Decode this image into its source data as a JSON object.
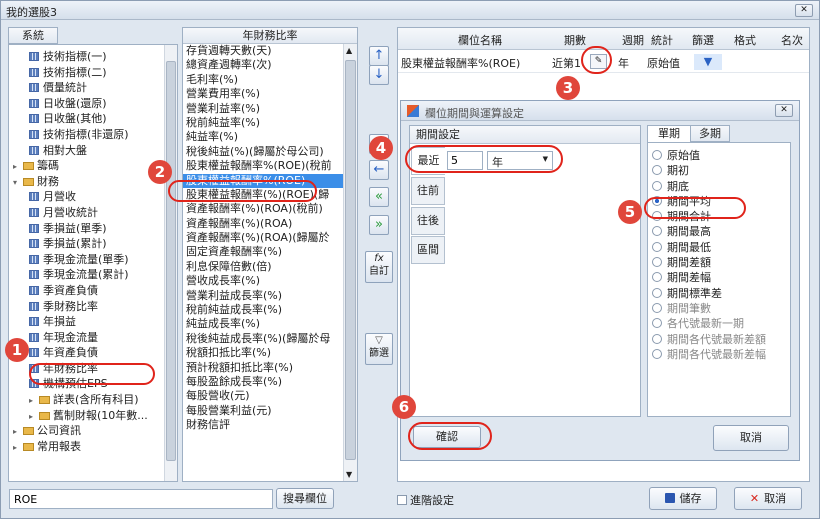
{
  "window": {
    "title": "我的選股3",
    "close_label": "✕"
  },
  "left": {
    "tab_label": "系統",
    "tree": [
      {
        "label": "技術指標(一)",
        "kind": "table",
        "indent": 1
      },
      {
        "label": "技術指標(二)",
        "kind": "table",
        "indent": 1
      },
      {
        "label": "價量統計",
        "kind": "table",
        "indent": 1
      },
      {
        "label": "日收盤(還原)",
        "kind": "table",
        "indent": 1
      },
      {
        "label": "日收盤(其他)",
        "kind": "table",
        "indent": 1
      },
      {
        "label": "技術指標(非還原)",
        "kind": "table",
        "indent": 1
      },
      {
        "label": "相對大盤",
        "kind": "table",
        "indent": 1
      },
      {
        "label": "籌碼",
        "kind": "folder",
        "indent": 0,
        "expander": "▸"
      },
      {
        "label": "財務",
        "kind": "folder",
        "indent": 0,
        "expander": "▾"
      },
      {
        "label": "月營收",
        "kind": "table",
        "indent": 1
      },
      {
        "label": "月營收統計",
        "kind": "table",
        "indent": 1
      },
      {
        "label": "季損益(單季)",
        "kind": "table",
        "indent": 1
      },
      {
        "label": "季損益(累計)",
        "kind": "table",
        "indent": 1
      },
      {
        "label": "季現金流量(單季)",
        "kind": "table",
        "indent": 1
      },
      {
        "label": "季現金流量(累計)",
        "kind": "table",
        "indent": 1
      },
      {
        "label": "季資產負債",
        "kind": "table",
        "indent": 1
      },
      {
        "label": "季財務比率",
        "kind": "table",
        "indent": 1
      },
      {
        "label": "年損益",
        "kind": "table",
        "indent": 1
      },
      {
        "label": "年現金流量",
        "kind": "table",
        "indent": 1
      },
      {
        "label": "年資產負債",
        "kind": "table",
        "indent": 1
      },
      {
        "label": "年財務比率",
        "kind": "table",
        "indent": 1
      },
      {
        "label": "機構預估EPS",
        "kind": "table",
        "indent": 1
      },
      {
        "label": "詳表(含所有科目)",
        "kind": "folder",
        "indent": 1,
        "expander": "▸"
      },
      {
        "label": "舊制財報(10年數...",
        "kind": "folder",
        "indent": 1,
        "expander": "▸"
      },
      {
        "label": "公司資訊",
        "kind": "folder",
        "indent": 0,
        "expander": "▸"
      },
      {
        "label": "常用報表",
        "kind": "folder",
        "indent": 0,
        "expander": "▸"
      }
    ],
    "search_value": "ROE",
    "search_button": "搜尋欄位"
  },
  "middle": {
    "header": "年財務比率",
    "items": [
      "存貨週轉天數(天)",
      "總資產週轉率(次)",
      "毛利率(%)",
      "營業費用率(%)",
      "營業利益率(%)",
      "稅前純益率(%)",
      "純益率(%)",
      "稅後純益(%)(歸屬於母公司)",
      "股東權益報酬率%(ROE)(稅前",
      "股東權益報酬率%(ROE)",
      "股東權益報酬率(%)(ROE)(歸",
      "資產報酬率(%)(ROA)(稅前)",
      "資產報酬率(%)(ROA)",
      "資產報酬率(%)(ROA)(歸屬於",
      "固定資產報酬率(%)",
      "利息保障倍數(倍)",
      "營收成長率(%)",
      "營業利益成長率(%)",
      "稅前純益成長率(%)",
      "純益成長率(%)",
      "稅後純益成長率(%)(歸屬於母",
      "稅額扣抵比率(%)",
      "預計稅額扣抵比率(%)",
      "每股盈餘成長率(%)",
      "每股營收(元)",
      "每股營業利益(元)",
      "財務信評"
    ],
    "selected_index": 9
  },
  "side_buttons": {
    "up": "↑",
    "down": "↓",
    "add": "→",
    "remove": "←",
    "add_all": "«",
    "remove_all": "»",
    "fx_label": "自訂",
    "fx": "fx",
    "filter_label": "篩選"
  },
  "grid": {
    "headers": [
      "欄位名稱",
      "期數",
      "週期",
      "統計",
      "篩選",
      "格式",
      "名次"
    ],
    "row": {
      "name": "股東權益報酬率%(ROE)",
      "period": "近第1",
      "cycle": "年",
      "stat": "原始值"
    }
  },
  "dialog": {
    "title": "欄位期間與運算設定",
    "close": "✕",
    "period_label": "期間設定",
    "tabs": [
      "最近",
      "往前",
      "往後",
      "區間"
    ],
    "recent_value": "5",
    "unit_value": "年",
    "mode_tabs": [
      "單期",
      "多期"
    ],
    "options": [
      {
        "label": "原始值",
        "state": "normal"
      },
      {
        "label": "期初",
        "state": "normal"
      },
      {
        "label": "期底",
        "state": "normal"
      },
      {
        "label": "期間平均",
        "state": "on"
      },
      {
        "label": "期間合計",
        "state": "normal"
      },
      {
        "label": "期間最高",
        "state": "normal"
      },
      {
        "label": "期間最低",
        "state": "normal"
      },
      {
        "label": "期間差額",
        "state": "normal"
      },
      {
        "label": "期間差幅",
        "state": "normal"
      },
      {
        "label": "期間標準差",
        "state": "normal"
      },
      {
        "label": "期間筆數",
        "state": "dim"
      },
      {
        "label": "各代號最新一期",
        "state": "dim"
      },
      {
        "label": "期間各代號最新差額",
        "state": "dim"
      },
      {
        "label": "期間各代號最新差幅",
        "state": "dim"
      }
    ],
    "ok": "確認",
    "cancel": "取消"
  },
  "bottom": {
    "advanced": "進階設定",
    "save": "儲存",
    "cancel": "取消"
  },
  "badges": [
    "1",
    "2",
    "3",
    "4",
    "5",
    "6"
  ],
  "colors": {
    "selection": "#3b8ee8",
    "badge": "#e0463b",
    "highlight": "#e0241b"
  }
}
